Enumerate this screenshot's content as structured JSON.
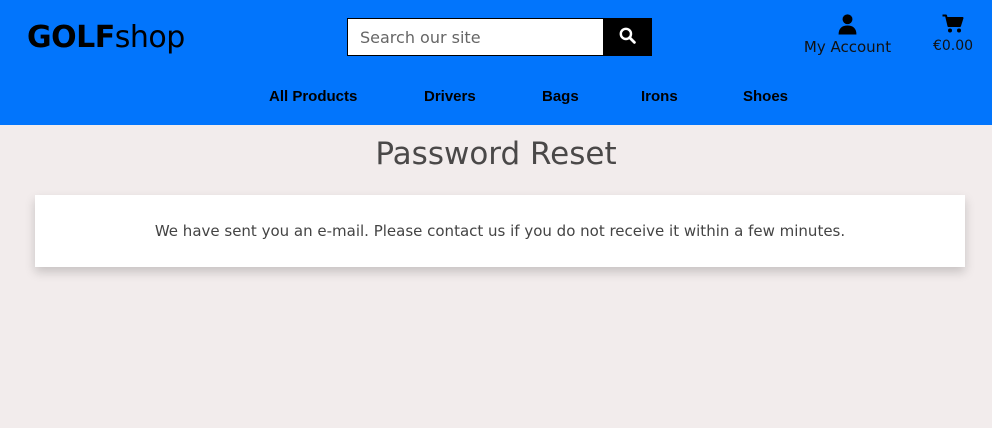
{
  "header": {
    "logo_bold": "GOLF",
    "logo_rest": "shop",
    "search_placeholder": "Search our site",
    "account_label": "My Account",
    "cart_total": "€0.00"
  },
  "nav": {
    "items": [
      "All Products",
      "Drivers",
      "Bags",
      "Irons",
      "Shoes"
    ]
  },
  "main": {
    "title": "Password Reset",
    "message": "We have sent you an e-mail. Please contact us if you do not receive it within a few minutes."
  },
  "colors": {
    "header_bg": "#0275fc",
    "page_bg": "#f2ecec"
  }
}
